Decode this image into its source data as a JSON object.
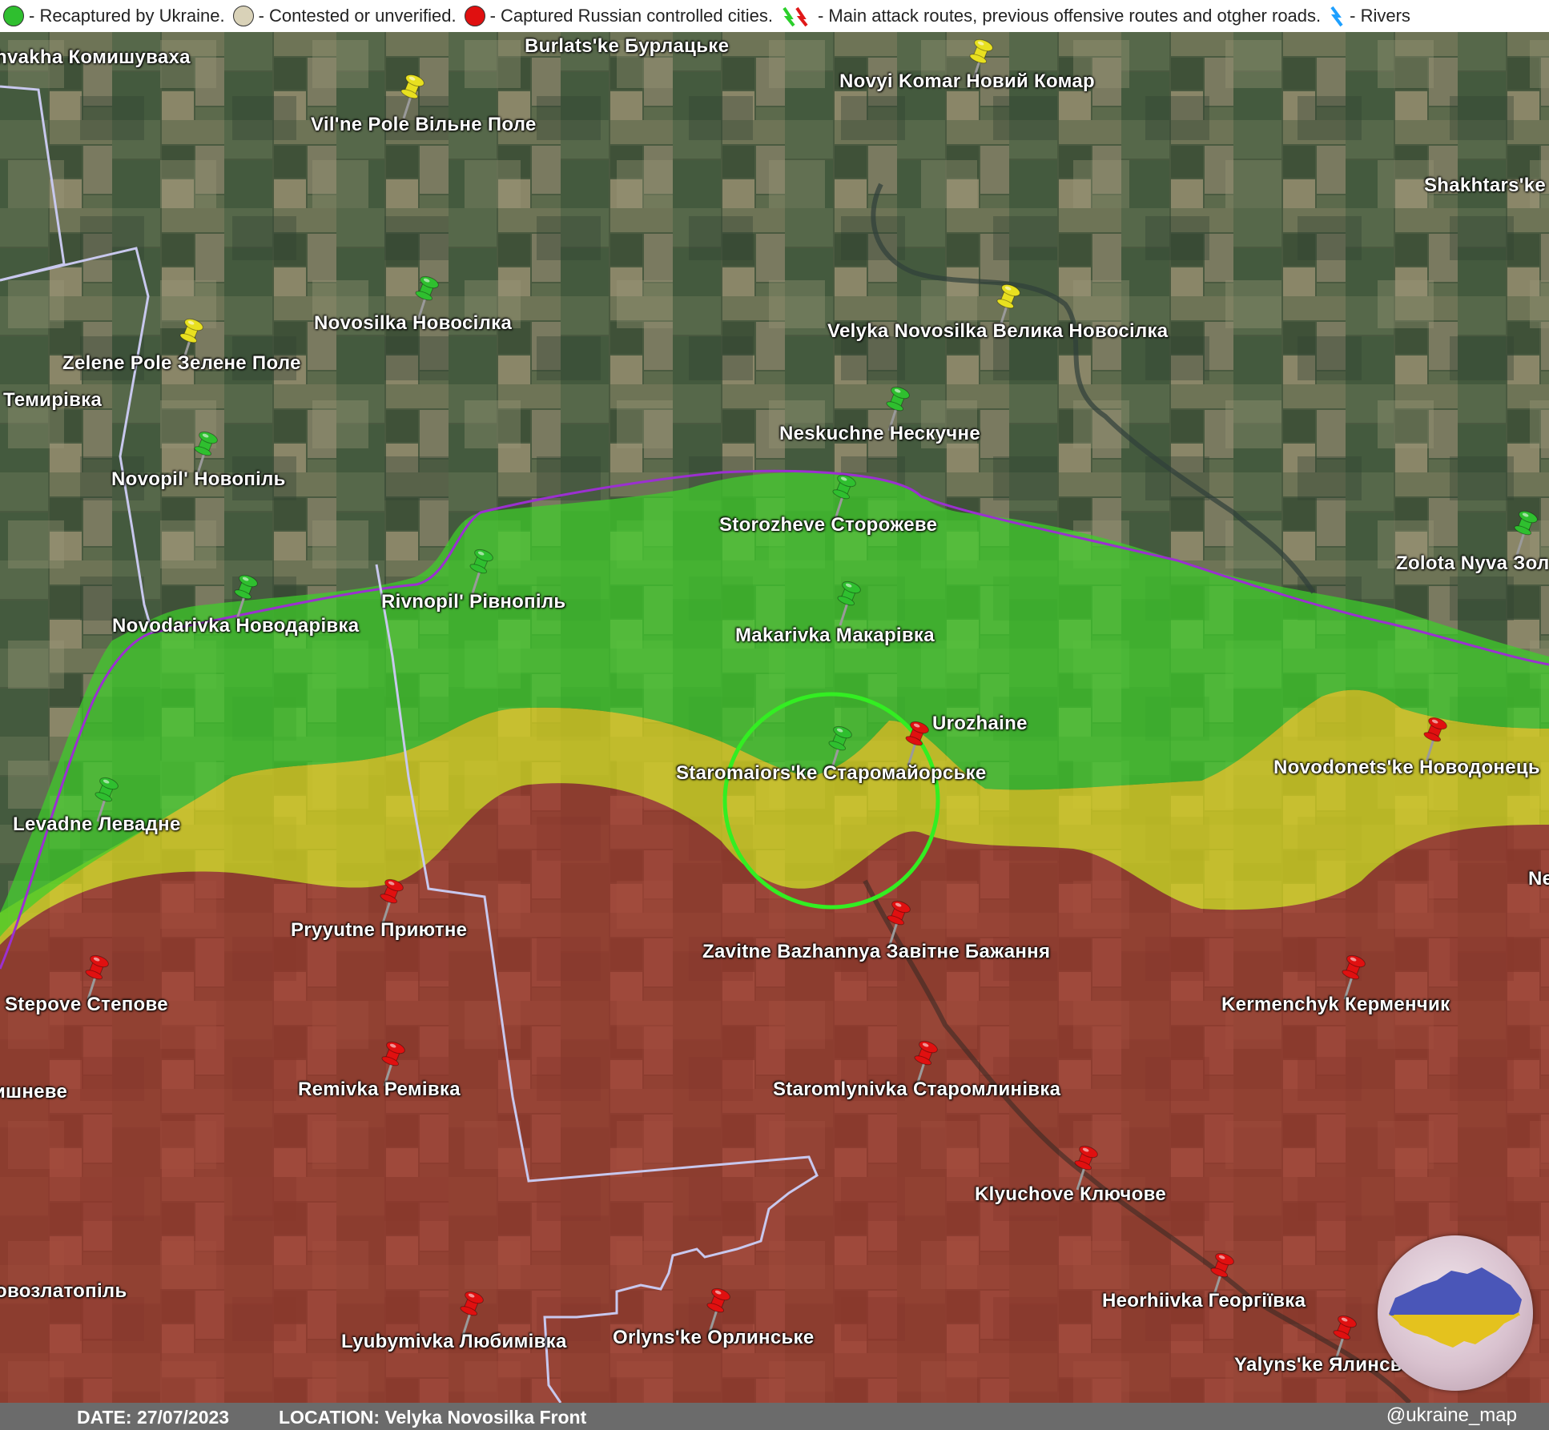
{
  "legend": {
    "ukraine": "- Recaptured by Ukraine.",
    "contested": "- Contested or unverified.",
    "russia": "- Captured Russian controlled cities.",
    "routes": "- Main attack routes, previous offensive routes and otgher roads.",
    "rivers": "- Rivers"
  },
  "colors": {
    "ukraine": "#2fbf2f",
    "contested": "#d9d2b8",
    "russia": "#e01010",
    "ukraine_zone": "#3fcf2a",
    "contested_zone": "#d8d020",
    "russia_zone": "#a8322a",
    "border": "#b8b8e0",
    "frontline": "#9b30d0",
    "highlight": "#33ee22"
  },
  "places": [
    {
      "name": "hvakha Комишуваха",
      "status": "none"
    },
    {
      "name": "Burlats'ke Бурлацьке",
      "status": "none"
    },
    {
      "name": "Novyi Komar Новий Комар",
      "status": "contested"
    },
    {
      "name": "Vil'ne Pole Вільне Поле",
      "status": "contested"
    },
    {
      "name": "Shakhtars'ke",
      "status": "none"
    },
    {
      "name": "Novosilka Новосілка",
      "status": "ukraine"
    },
    {
      "name": "Velyka Novosilka Велика Новосілка",
      "status": "contested"
    },
    {
      "name": "Zelene Pole Зелене Поле",
      "status": "contested"
    },
    {
      "name": "Темирівка",
      "status": "none"
    },
    {
      "name": "Neskuchne Нескучне",
      "status": "ukraine"
    },
    {
      "name": "Novopil' Новопіль",
      "status": "ukraine"
    },
    {
      "name": "Storozheve Сторожеве",
      "status": "ukraine"
    },
    {
      "name": "Zolota Nyva Зол",
      "status": "ukraine"
    },
    {
      "name": "Rivnopil' Рівнопіль",
      "status": "ukraine"
    },
    {
      "name": "Novodarivka Новодарівка",
      "status": "ukraine"
    },
    {
      "name": "Makarivka Макарівка",
      "status": "ukraine"
    },
    {
      "name": "Urozhaine",
      "status": "russia"
    },
    {
      "name": "Staromaiors'ke Старомайорське",
      "status": "ukraine"
    },
    {
      "name": "Novodonets'ke Новодонець",
      "status": "russia"
    },
    {
      "name": "Levadne Левадне",
      "status": "ukraine"
    },
    {
      "name": "Ne",
      "status": "none"
    },
    {
      "name": "Pryyutne Приютне",
      "status": "russia"
    },
    {
      "name": "Zavitne Bazhannya Завітне Бажання",
      "status": "russia"
    },
    {
      "name": "Stepove Степове",
      "status": "russia"
    },
    {
      "name": "Kermenchyk Керменчик",
      "status": "russia"
    },
    {
      "name": "ишневе",
      "status": "none"
    },
    {
      "name": "Remivka Ремівка",
      "status": "russia"
    },
    {
      "name": "Staromlynivka Старомлинівка",
      "status": "russia"
    },
    {
      "name": "Klyuchove Ключове",
      "status": "russia"
    },
    {
      "name": "овозлатопіль",
      "status": "none"
    },
    {
      "name": "Heorhiivka Георгіївка",
      "status": "russia"
    },
    {
      "name": "Lyubymivka Любимівка",
      "status": "russia"
    },
    {
      "name": "Orlyns'ke Орлинське",
      "status": "russia"
    },
    {
      "name": "Yalyns'ke Ялинське",
      "status": "russia"
    }
  ],
  "footer": {
    "date": "DATE: 27/07/2023",
    "location": "LOCATION: Velyka Novosilka Front",
    "handle": "@ukraine_map"
  }
}
